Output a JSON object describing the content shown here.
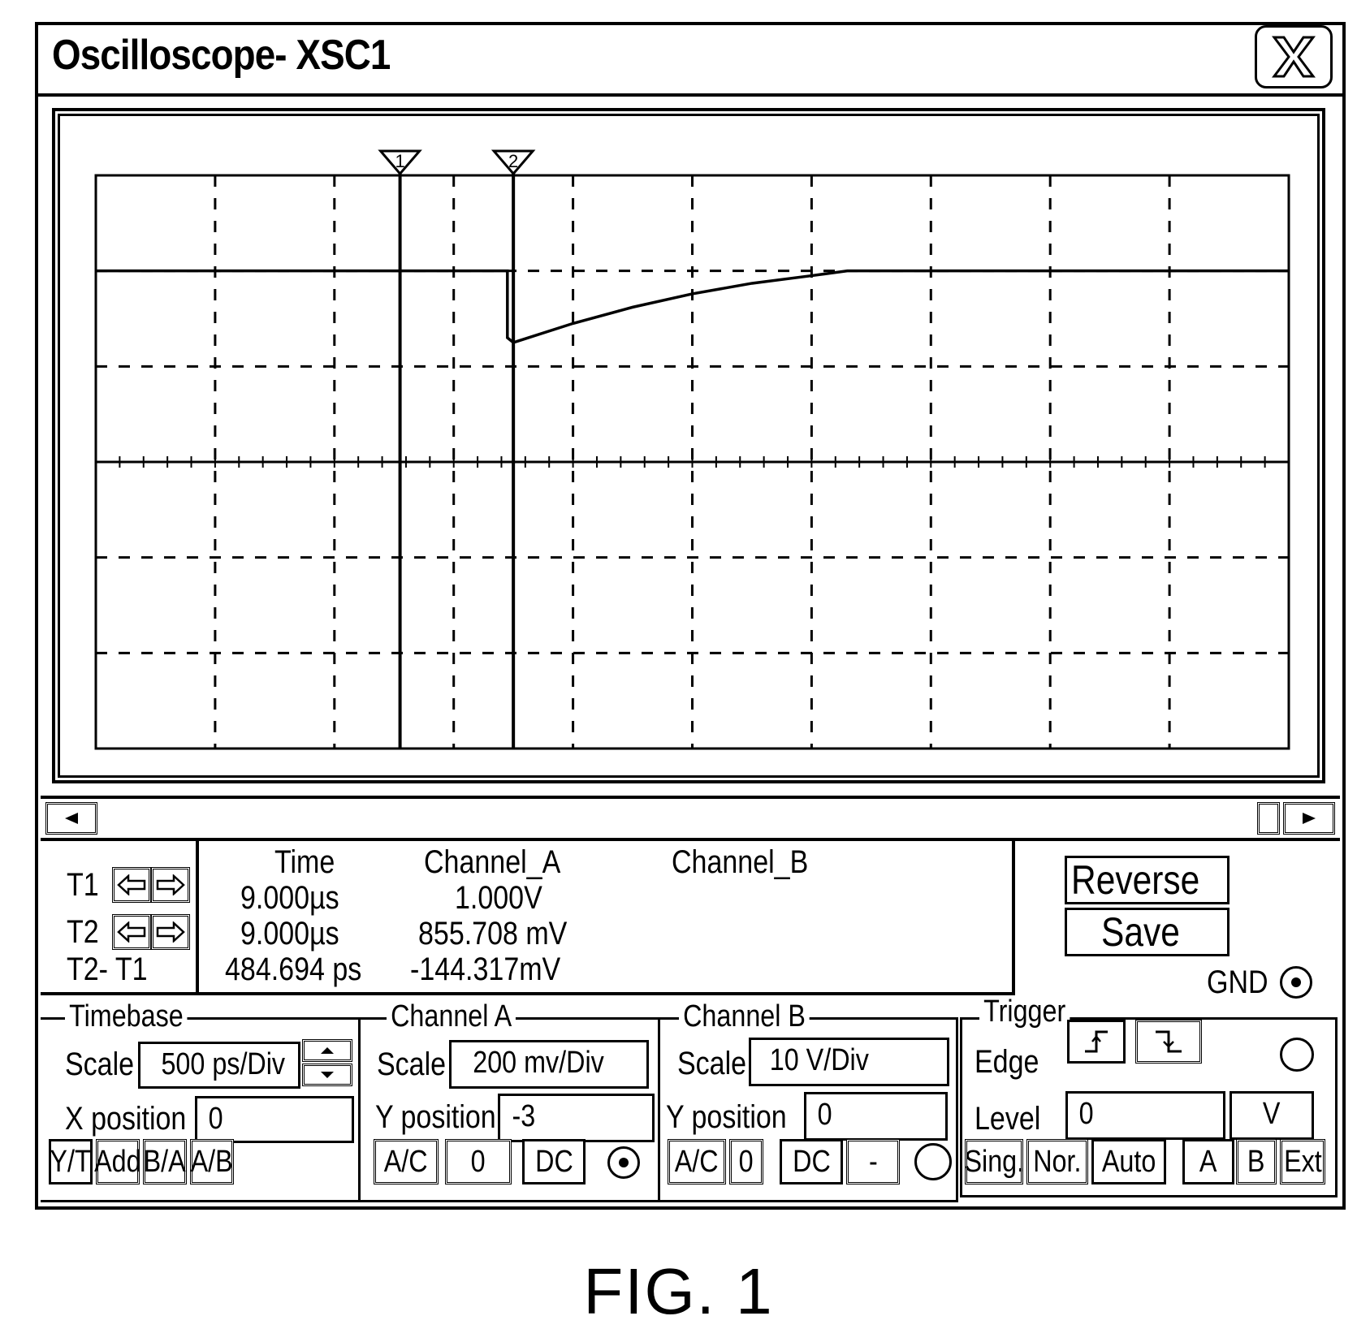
{
  "window": {
    "title": "Oscilloscope- XSC1",
    "close_icon": "close-x-icon"
  },
  "chart_data": {
    "type": "line",
    "title": "",
    "xlabel": "",
    "ylabel": "",
    "grid": true,
    "x_divisions": 10,
    "y_divisions": 6,
    "x_unit": "div",
    "y_unit": "div",
    "xlim": [
      0,
      10
    ],
    "ylim": [
      -3,
      3
    ],
    "series": [
      {
        "name": "Channel_A",
        "x": [
          0,
          3.45,
          3.45,
          3.5,
          4.0,
          4.5,
          5.0,
          5.5,
          6.0,
          6.3,
          6.5,
          10
        ],
        "y": [
          2.0,
          2.0,
          1.3,
          1.25,
          1.45,
          1.62,
          1.76,
          1.87,
          1.95,
          2.0,
          2.0,
          2.0
        ]
      }
    ],
    "cursors": [
      {
        "label": "1",
        "x": 2.55
      },
      {
        "label": "2",
        "x": 3.5
      }
    ]
  },
  "scrollbar": {
    "left_icon": "scroll-left-icon",
    "right_icon": "scroll-right-icon"
  },
  "readout": {
    "rows": [
      {
        "label": "T1",
        "time": "9.000µs",
        "channel_a": "1.000V",
        "channel_b": ""
      },
      {
        "label": "T2",
        "time": "9.000µs",
        "channel_a": "855.708 mV",
        "channel_b": ""
      },
      {
        "label": "T2- T1",
        "time": "484.694 ps",
        "channel_a": "-144.317mV",
        "channel_b": ""
      }
    ],
    "headers": {
      "time": "Time",
      "channel_a": "Channel_A",
      "channel_b": "Channel_B"
    }
  },
  "actions": {
    "reverse": "Reverse",
    "save": "Save",
    "gnd": "GND"
  },
  "timebase": {
    "legend": "Timebase",
    "scale_label": "Scale",
    "scale_value": "500 ps/Div",
    "xpos_label": "X position",
    "xpos_value": "0",
    "buttons": [
      "Y/T",
      "Add",
      "B/A",
      "A/B"
    ]
  },
  "channel_a": {
    "legend": "Channel A",
    "scale_label": "Scale",
    "scale_value": "200 mv/Div",
    "ypos_label": "Y position",
    "ypos_value": "-3",
    "buttons": [
      "A/C",
      "0",
      "DC"
    ],
    "radio_selected": true
  },
  "channel_b": {
    "legend": "Channel B",
    "scale_label": "Scale",
    "scale_value": "10  V/Div",
    "ypos_label": "Y position",
    "ypos_value": "0",
    "buttons": [
      "A/C",
      "0",
      "DC",
      "-"
    ],
    "radio_selected": false
  },
  "trigger": {
    "legend": "Trigger",
    "edge_label": "Edge",
    "level_label": "Level",
    "level_value": "0",
    "level_unit": "V",
    "radio_selected": false,
    "mode_buttons": [
      "Sing.",
      "Nor.",
      "Auto"
    ],
    "source_buttons": [
      "A",
      "B",
      "Ext"
    ]
  },
  "caption": "FIG. 1"
}
